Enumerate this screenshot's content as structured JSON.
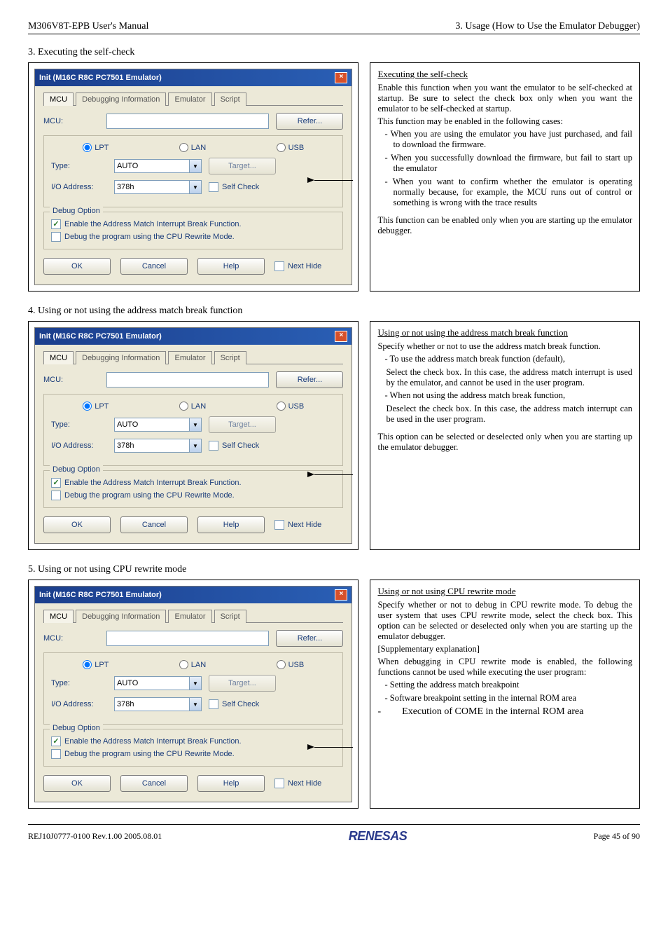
{
  "header": {
    "left": "M306V8T-EPB User's Manual",
    "right": "3. Usage (How to Use the Emulator Debugger)"
  },
  "section3": {
    "title": "3. Executing the self-check",
    "explain_heading": "Executing the self-check",
    "p1": "Enable this function when you want the emulator to be self-checked at startup. Be sure to select the check box only when you want the emulator to be self-checked at startup.",
    "p2": "This function may be enabled in the following cases:",
    "li1": "When you are using the emulator you have just purchased, and fail to download the firmware.",
    "li2": "When you successfully download the firmware, but fail to start up the emulator",
    "li3": "When you want to confirm whether the emulator is operating normally because, for example, the MCU runs out of control or something is wrong with the trace results",
    "p3": "This function can be enabled only when you are starting up the emulator debugger."
  },
  "section4": {
    "title": "4. Using or not using the address match break function",
    "explain_heading": "Using or not using the address match break function",
    "p1": "Specify whether or not to use the address match break function.",
    "li1": "To use the address match break function (default),",
    "li1b": "Select the check box. In this case, the address match interrupt is used by the emulator, and cannot be used in the user program.",
    "li2": "When not using the address match break function,",
    "li2b": "Deselect the check box. In this case, the address match interrupt can be used in the user program.",
    "p3": "This option can be selected or deselected only when you are starting up the emulator debugger."
  },
  "section5": {
    "title": "5. Using or not using CPU rewrite mode",
    "explain_heading": "Using or not using CPU rewrite mode",
    "p1": "Specify whether or not to debug in CPU rewrite mode. To debug the user system that uses CPU rewrite mode, select the check box. This option can be selected or deselected only when you are starting up the emulator debugger.",
    "p2": "[Supplementary explanation]",
    "p3": "When debugging in CPU rewrite mode is enabled, the following functions cannot be used while executing the user program:",
    "li1": "Setting the address match breakpoint",
    "li2": "Software breakpoint setting in the internal ROM area",
    "li3t": "Execution of COME in the internal ROM area"
  },
  "dialog": {
    "title": "Init (M16C R8C PC7501 Emulator)",
    "tabs": {
      "mcu": "MCU",
      "dbg": "Debugging Information",
      "emu": "Emulator",
      "scr": "Script"
    },
    "mcu_label": "MCU:",
    "refer": "Refer...",
    "lpt": "LPT",
    "lan": "LAN",
    "usb": "USB",
    "type": "Type:",
    "type_val": "AUTO",
    "target": "Target...",
    "io": "I/O Address:",
    "io_val": "378h",
    "selfcheck": "Self Check",
    "grp": "Debug Option",
    "chk1": "Enable the Address Match Interrupt Break Function.",
    "chk2": "Debug the program using the CPU Rewrite Mode.",
    "ok": "OK",
    "cancel": "Cancel",
    "help": "Help",
    "nexthide": "Next Hide"
  },
  "footer": {
    "left": "REJ10J0777-0100   Rev.1.00   2005.08.01",
    "logo": "RENESAS",
    "right": "Page 45 of 90"
  }
}
